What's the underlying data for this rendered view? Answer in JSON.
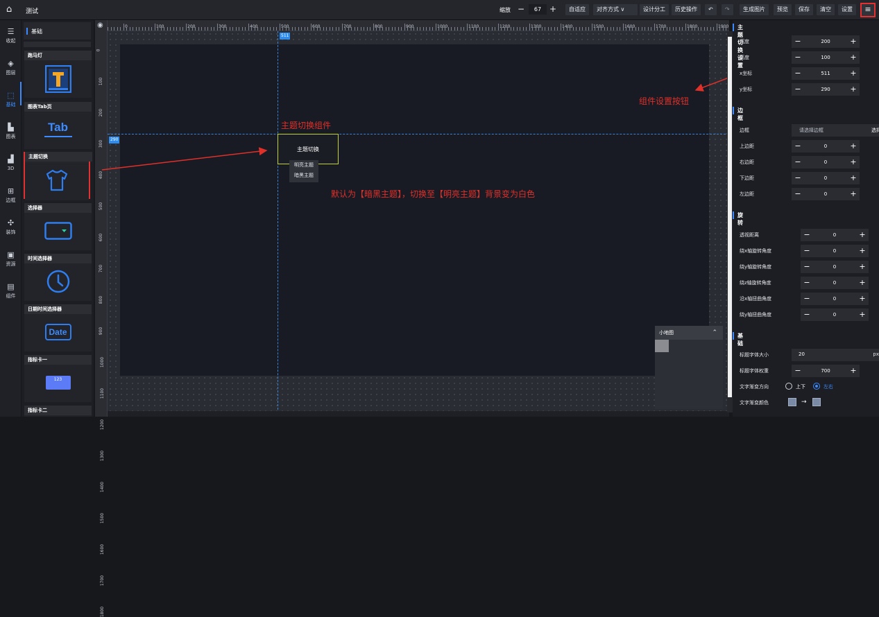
{
  "app": {
    "title": "测试"
  },
  "toolbar": {
    "zoom_label": "缩放",
    "zoom_minus": "−",
    "zoom_value": "67",
    "zoom_plus": "+",
    "fit": "自适应",
    "align": "对齐方式 ∨",
    "design": "设计分工",
    "history": "历史操作",
    "undo": "↶",
    "redo": "↷",
    "gen_image": "生成图片",
    "preview": "预览",
    "save": "保存",
    "clear": "清空",
    "settings": "设置",
    "menu": "≡"
  },
  "rail": {
    "items": [
      {
        "label": "收起",
        "icon": "collapse-icon",
        "glyph": "☰"
      },
      {
        "label": "图层",
        "icon": "layers-icon",
        "glyph": "◈"
      },
      {
        "label": "基础",
        "icon": "basic-icon",
        "glyph": "⬚"
      },
      {
        "label": "图表",
        "icon": "chart-icon",
        "glyph": "▙"
      },
      {
        "label": "3D",
        "icon": "3d-icon",
        "glyph": "▟"
      },
      {
        "label": "边框",
        "icon": "border-icon",
        "glyph": "⊞"
      },
      {
        "label": "装饰",
        "icon": "decoration-icon",
        "glyph": "✣"
      },
      {
        "label": "资源",
        "icon": "resource-icon",
        "glyph": "▣"
      },
      {
        "label": "组件",
        "icon": "component-icon",
        "glyph": "▤"
      }
    ]
  },
  "panel": {
    "title": "基础",
    "cards": [
      {
        "title": "跑马灯"
      },
      {
        "title": "图表Tab页",
        "icon_text": "Tab"
      },
      {
        "title": "主题切换"
      },
      {
        "title": "选择器"
      },
      {
        "title": "时间选择器"
      },
      {
        "title": "日期时间选择器",
        "icon_text": "Date"
      },
      {
        "title": "指标卡一",
        "icon_text": "123"
      },
      {
        "title": "指标卡二"
      }
    ]
  },
  "ruler": {
    "h_labels": [
      "0",
      "100",
      "200",
      "300",
      "400",
      "500",
      "600",
      "700",
      "800",
      "900",
      "1000",
      "1100",
      "1200",
      "1300",
      "1400",
      "1500",
      "1600",
      "1700",
      "1800",
      "1900"
    ],
    "v_labels": [
      "0",
      "100",
      "200",
      "300",
      "400",
      "500",
      "600",
      "700",
      "800",
      "900",
      "1000",
      "1100",
      "1200",
      "1300",
      "1400",
      "1500",
      "1600",
      "1700",
      "1800"
    ],
    "x_tag": "511",
    "y_tag": "290"
  },
  "canvas": {
    "component_title": "主题切换",
    "options": [
      "明亮主题",
      "暗黑主题"
    ],
    "annotation_component": "主题切换组件",
    "annotation_default": "默认为【暗黑主题】，切换至【明亮主题】背景变为白色",
    "annotation_settings": "组件设置按钮"
  },
  "minimap": {
    "title": "小地图",
    "chevron": "⌃"
  },
  "settings": {
    "title": "主题切换设置",
    "size": [
      {
        "label": "宽度",
        "value": "200"
      },
      {
        "label": "高度",
        "value": "100"
      },
      {
        "label": "x坐标",
        "value": "511"
      },
      {
        "label": "y坐标",
        "value": "290"
      }
    ],
    "border_section": "边框",
    "border": {
      "label": "边框",
      "placeholder": "请选择边框",
      "button": "选择"
    },
    "margins": [
      {
        "label": "上边距",
        "value": "0"
      },
      {
        "label": "右边距",
        "value": "0"
      },
      {
        "label": "下边距",
        "value": "0"
      },
      {
        "label": "左边距",
        "value": "0"
      }
    ],
    "rotate_section": "旋转",
    "rotates": [
      {
        "label": "透视距离",
        "value": "0"
      },
      {
        "label": "绕x轴旋转角度",
        "value": "0"
      },
      {
        "label": "绕y轴旋转角度",
        "value": "0"
      },
      {
        "label": "绕z轴旋转角度",
        "value": "0"
      },
      {
        "label": "沿x轴扭曲角度",
        "value": "0"
      },
      {
        "label": "绕y轴扭曲角度",
        "value": "0"
      }
    ],
    "base_section": "基础",
    "font_size": {
      "label": "标题字体大小",
      "value": "20",
      "unit": "px"
    },
    "font_weight": {
      "label": "标题字体权重",
      "value": "700"
    },
    "gradient_dir": {
      "label": "文字渐变方向",
      "opt1": "上下",
      "opt2": "左右"
    },
    "gradient_color": {
      "label": "文字渐变颜色",
      "arrow": "→"
    }
  },
  "colors": {
    "accent": "#3d8bff",
    "annotation": "#e0302a",
    "highlight": "#e33030"
  }
}
